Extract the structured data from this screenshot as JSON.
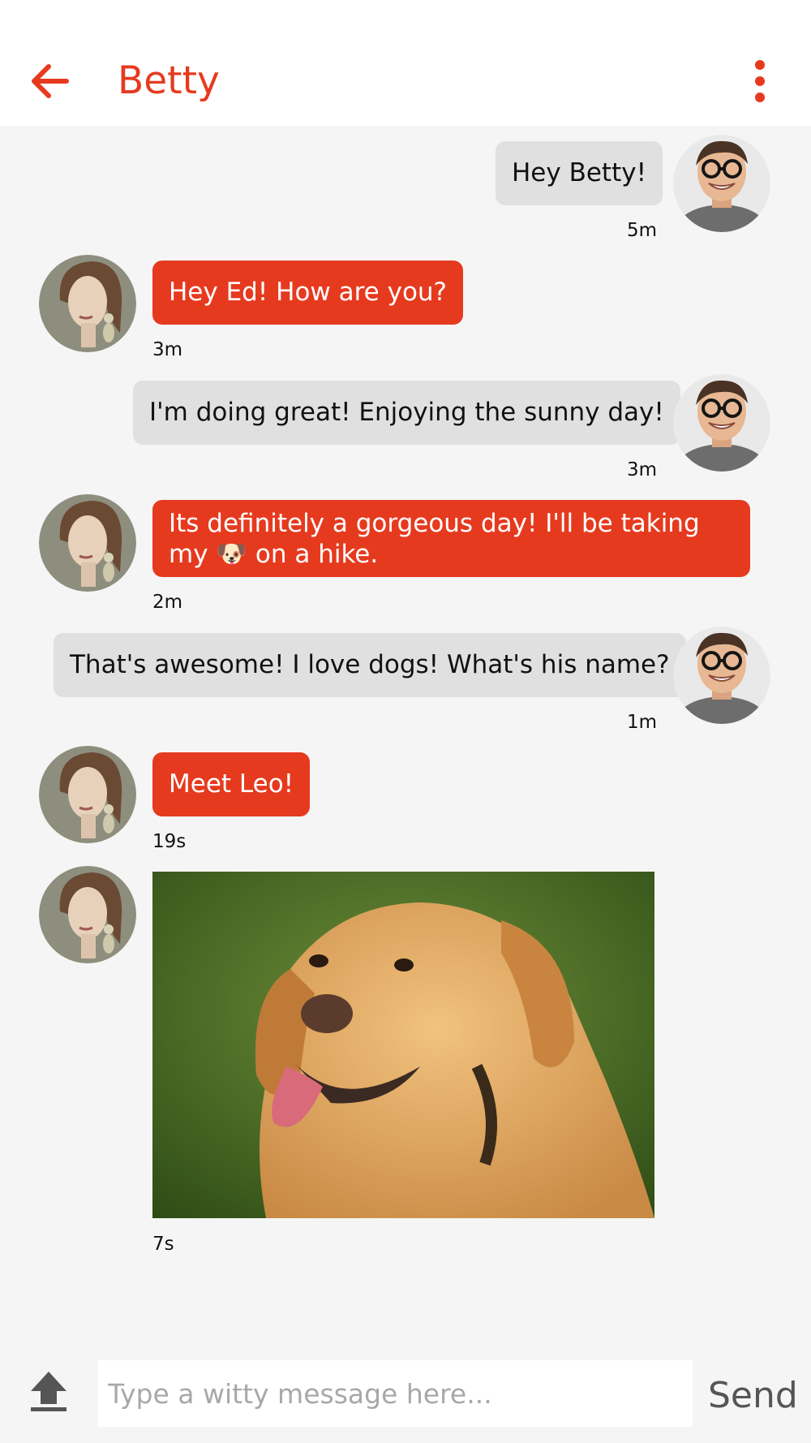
{
  "header": {
    "title": "Betty",
    "back_icon": "arrow-left-icon",
    "menu_icon": "more-vertical-icon"
  },
  "messages": [
    {
      "from": "Ed",
      "direction": "sent",
      "text": "Hey Betty!",
      "time": "5m"
    },
    {
      "from": "Betty",
      "direction": "received",
      "text": "Hey Ed! How are you?",
      "time": "3m"
    },
    {
      "from": "Ed",
      "direction": "sent",
      "text": "I'm doing great! Enjoying the sunny day!",
      "time": "3m"
    },
    {
      "from": "Betty",
      "direction": "received",
      "text_before_emoji": "Its definitely a gorgeous day! I'll be taking my",
      "emoji": "🐶",
      "text_after_emoji": "on a hike.",
      "time": "2m"
    },
    {
      "from": "Ed",
      "direction": "sent",
      "text": "That's awesome! I love dogs! What's his name?",
      "time": "1m"
    },
    {
      "from": "Betty",
      "direction": "received",
      "text": "Meet Leo!",
      "time": "19s"
    },
    {
      "from": "Betty",
      "direction": "received",
      "image": "dog-photo",
      "time": "7s"
    }
  ],
  "composer": {
    "placeholder": "Type a witty message here...",
    "send_label": "Send",
    "upload_icon": "upload-icon"
  },
  "colors": {
    "accent": "#e63a1f",
    "background": "#f5f5f5",
    "sent_bubble": "#e0e0e0",
    "received_text": "#ffffff"
  }
}
